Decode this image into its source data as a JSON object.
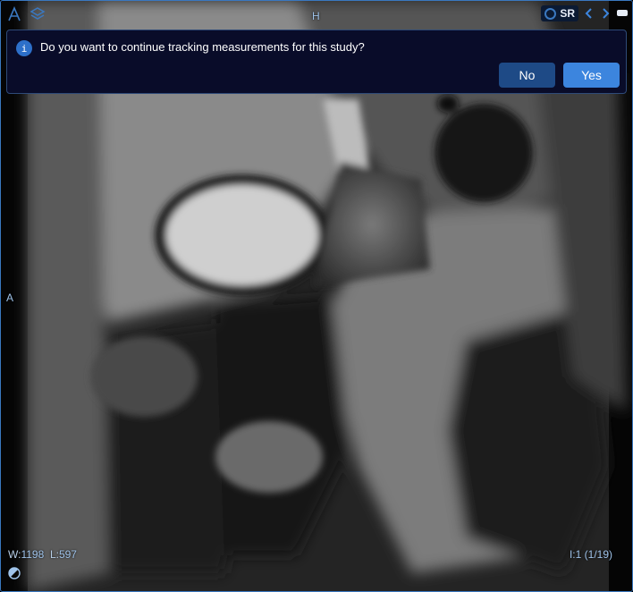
{
  "orientation": {
    "top": "H",
    "left": "A"
  },
  "notification": {
    "icon": "info-icon",
    "message": "Do you want to continue tracking measurements for this study?",
    "no_label": "No",
    "yes_label": "Yes"
  },
  "toolbar": {
    "sr_label": "SR"
  },
  "window_level": {
    "w_label": "W:",
    "w_value": "1198",
    "l_label": "L:",
    "l_value": "597"
  },
  "image_index": "I:1 (1/19)",
  "colors": {
    "accent": "#3c85de",
    "border": "#3a78c0",
    "overlay_text": "#9fc3ea",
    "notification_bg": "#090c29"
  }
}
